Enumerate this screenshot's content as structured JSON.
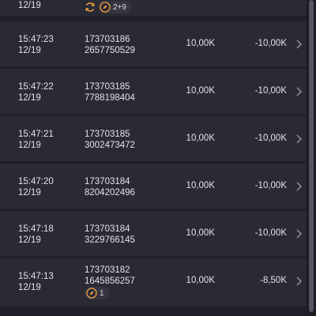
{
  "partial_row": {
    "date": "12/19",
    "badge_count": "2+9"
  },
  "rows": [
    {
      "time": "15:47:23",
      "date": "12/19",
      "id_line1": "173703186",
      "id_line2": "2657750529",
      "amount": "10,00K",
      "net": "-10,00K"
    },
    {
      "time": "15:47:22",
      "date": "12/19",
      "id_line1": "173703185",
      "id_line2": "7788198404",
      "amount": "10,00K",
      "net": "-10,00K"
    },
    {
      "time": "15:47:21",
      "date": "12/19",
      "id_line1": "173703185",
      "id_line2": "3002473472",
      "amount": "10,00K",
      "net": "-10,00K"
    },
    {
      "time": "15:47:20",
      "date": "12/19",
      "id_line1": "173703184",
      "id_line2": "8204202496",
      "amount": "10,00K",
      "net": "-10,00K"
    },
    {
      "time": "15:47:18",
      "date": "12/19",
      "id_line1": "173703184",
      "id_line2": "3229766145",
      "amount": "10,00K",
      "net": "-10,00K"
    },
    {
      "time": "15:47:13",
      "date": "12/19",
      "id_line1": "173703182",
      "id_line2": "1645856257",
      "amount": "10,00K",
      "net": "-8,50K",
      "badge_count": "1"
    }
  ],
  "icons": {
    "chevron": "chevron-right-icon",
    "refresh": "refresh-badge-icon",
    "compass": "compass-badge-icon"
  },
  "colors": {
    "row_bg": "#2a2a35",
    "page_bg": "#1f1f27",
    "accent_orange": "#f0a23c"
  }
}
